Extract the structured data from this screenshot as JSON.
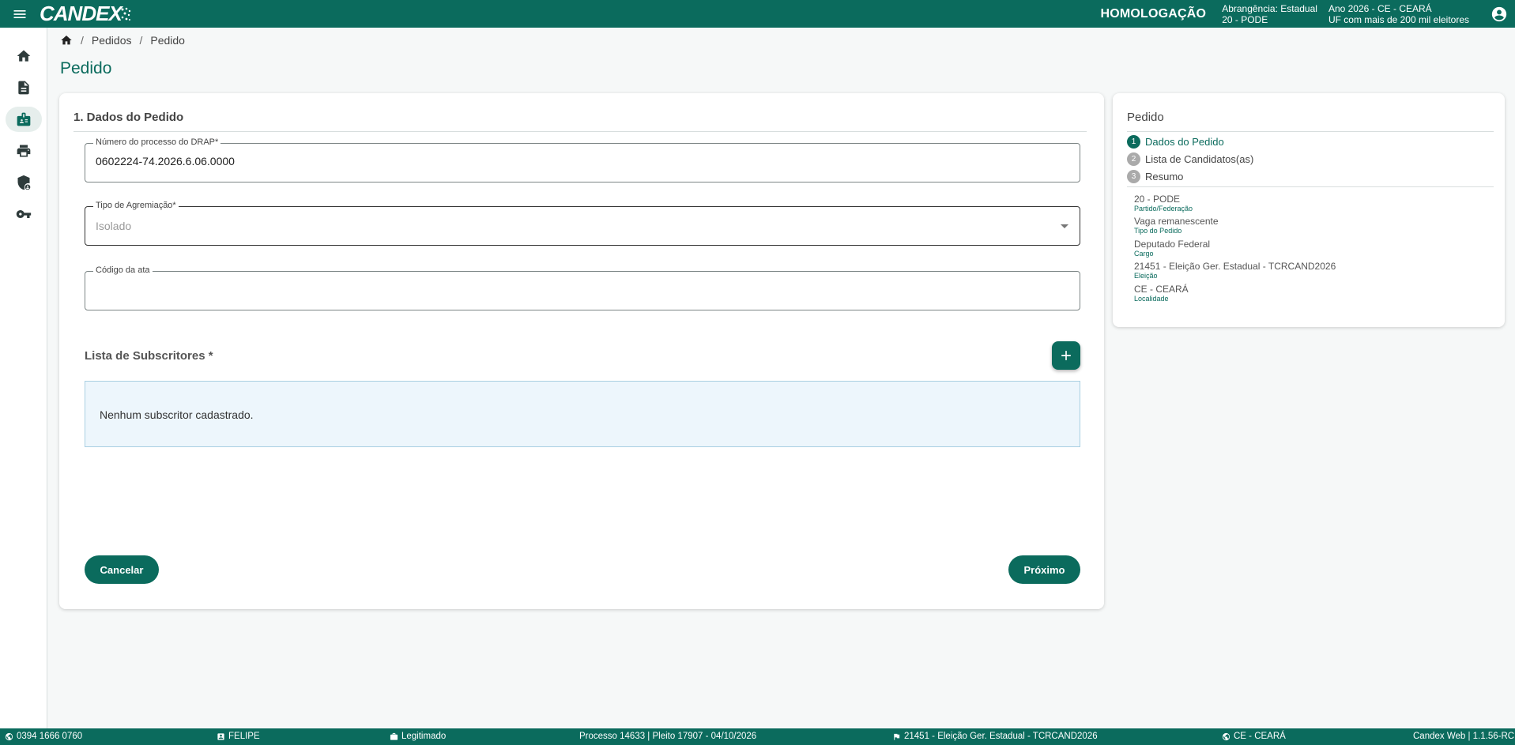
{
  "header": {
    "logo": "CANDEX",
    "environment": "HOMOLOGAÇÃO",
    "abrangencia_line1": "Abrangência: Estadual",
    "abrangencia_line2": "20 - PODE",
    "ano_line1": "Ano 2026 - CE - CEARÁ",
    "ano_line2": "UF com mais de 200 mil eleitores",
    "colors": {
      "primary": "#0b6b5d"
    }
  },
  "sidebar": {
    "icons": [
      "home-icon",
      "document-icon",
      "id-badge-icon",
      "printer-icon",
      "shield-icon",
      "key-icon"
    ],
    "active": "id-badge-icon"
  },
  "breadcrumb": {
    "items": [
      "Pedidos",
      "Pedido"
    ]
  },
  "page": {
    "title": "Pedido"
  },
  "form": {
    "section_title": "1. Dados do Pedido",
    "drap": {
      "label": "Número do processo do DRAP*",
      "value": "0602224-74.2026.6.06.0000"
    },
    "tipo": {
      "label": "Tipo de Agremiação*",
      "value": "Isolado"
    },
    "codigo": {
      "label": "Código da ata",
      "value": ""
    },
    "subscritores": {
      "title": "Lista de Subscritores *",
      "empty": "Nenhum subscritor cadastrado."
    },
    "cancel_label": "Cancelar",
    "next_label": "Próximo"
  },
  "summary": {
    "title": "Pedido",
    "steps": [
      {
        "num": "1",
        "label": "Dados do Pedido"
      },
      {
        "num": "2",
        "label": "Lista de Candidatos(as)"
      },
      {
        "num": "3",
        "label": "Resumo"
      }
    ],
    "info": [
      {
        "value": "20 - PODE",
        "key": "Partido/Federação"
      },
      {
        "value": "Vaga remanescente",
        "key": "Tipo do Pedido"
      },
      {
        "value": "Deputado Federal",
        "key": "Cargo"
      },
      {
        "value": "21451 - Eleição Ger. Estadual - TCRCAND2026",
        "key": "Eleição"
      },
      {
        "value": "CE - CEARÁ",
        "key": "Localidade"
      }
    ]
  },
  "footer": {
    "phone": "0394 1666 0760",
    "user": "FELIPE",
    "role": "Legitimado",
    "processo": "Processo 14633 | Pleito 17907 - 04/10/2026",
    "eleicao": "21451 - Eleição Ger. Estadual - TCRCAND2026",
    "local": "CE - CEARÁ",
    "version": "Candex Web | 1.1.56-RC"
  }
}
